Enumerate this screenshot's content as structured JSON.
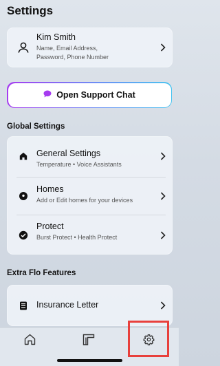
{
  "page": {
    "title": "Settings"
  },
  "profile": {
    "name": "Kim Smith",
    "line1": "Name, Email Address,",
    "line2": "Password, Phone Number",
    "icon": "person-icon"
  },
  "support": {
    "label": "Open Support Chat",
    "icon": "chat-bubble-icon",
    "accent": "#a63cf0"
  },
  "global_settings": {
    "heading": "Global Settings",
    "items": [
      {
        "title": "General Settings",
        "subtitle": "Temperature • Voice Assistants",
        "icon": "house-icon"
      },
      {
        "title": "Homes",
        "subtitle": "Add or Edit homes for your devices",
        "icon": "location-pin-icon"
      },
      {
        "title": "Protect",
        "subtitle": "Burst Protect • Health Protect",
        "icon": "check-circle-icon"
      }
    ]
  },
  "extra_features": {
    "heading": "Extra Flo Features",
    "items": [
      {
        "title": "Insurance Letter",
        "icon": "document-icon"
      }
    ]
  },
  "tabbar": {
    "tabs": [
      {
        "name": "home",
        "icon": "home-outline-icon"
      },
      {
        "name": "devices",
        "icon": "devices-icon"
      },
      {
        "name": "settings",
        "icon": "gear-icon"
      }
    ],
    "highlight_color": "#e8403c"
  }
}
